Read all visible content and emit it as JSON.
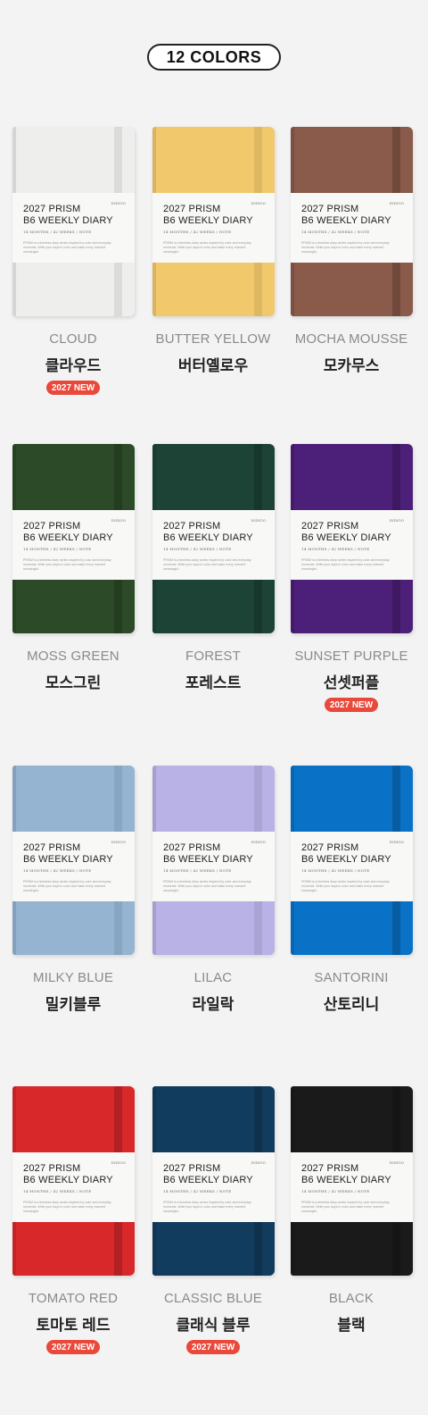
{
  "header": {
    "title": "12 COLORS"
  },
  "product": {
    "title_line1": "2027 PRISM",
    "title_line2": "B6 WEEKLY DIARY",
    "sub": "14 MONTHS / 42 WEEKS / NOTE",
    "desc": "PRISM is a timeless diary series inspired by color and everyday moments. Write your days in color and make every moment meaningful.",
    "brand": "INDIGO"
  },
  "badge_label": "2027 NEW",
  "colors": [
    {
      "en": "CLOUD",
      "ko": "클라우드",
      "hex": "#eeeeec",
      "isNew": true
    },
    {
      "en": "BUTTER YELLOW",
      "ko": "버터옐로우",
      "hex": "#f2c86c",
      "isNew": false
    },
    {
      "en": "MOCHA MOUSSE",
      "ko": "모카무스",
      "hex": "#8a5a4a",
      "isNew": false
    },
    {
      "en": "MOSS GREEN",
      "ko": "모스그린",
      "hex": "#2c4a28",
      "isNew": false
    },
    {
      "en": "FOREST",
      "ko": "포레스트",
      "hex": "#1d4236",
      "isNew": false
    },
    {
      "en": "SUNSET PURPLE",
      "ko": "선셋퍼플",
      "hex": "#4c1f78",
      "isNew": true
    },
    {
      "en": "MILKY BLUE",
      "ko": "밀키블루",
      "hex": "#94b4d2",
      "isNew": false
    },
    {
      "en": "LILAC",
      "ko": "라일락",
      "hex": "#b9b2e6",
      "isNew": false
    },
    {
      "en": "SANTORINI",
      "ko": "산토리니",
      "hex": "#0a72c6",
      "isNew": false
    },
    {
      "en": "TOMATO RED",
      "ko": "토마토 레드",
      "hex": "#d8282a",
      "isNew": true
    },
    {
      "en": "CLASSIC BLUE",
      "ko": "클래식 블루",
      "hex": "#123c5e",
      "isNew": true
    },
    {
      "en": "BLACK",
      "ko": "블랙",
      "hex": "#1a1a1a",
      "isNew": false
    }
  ]
}
